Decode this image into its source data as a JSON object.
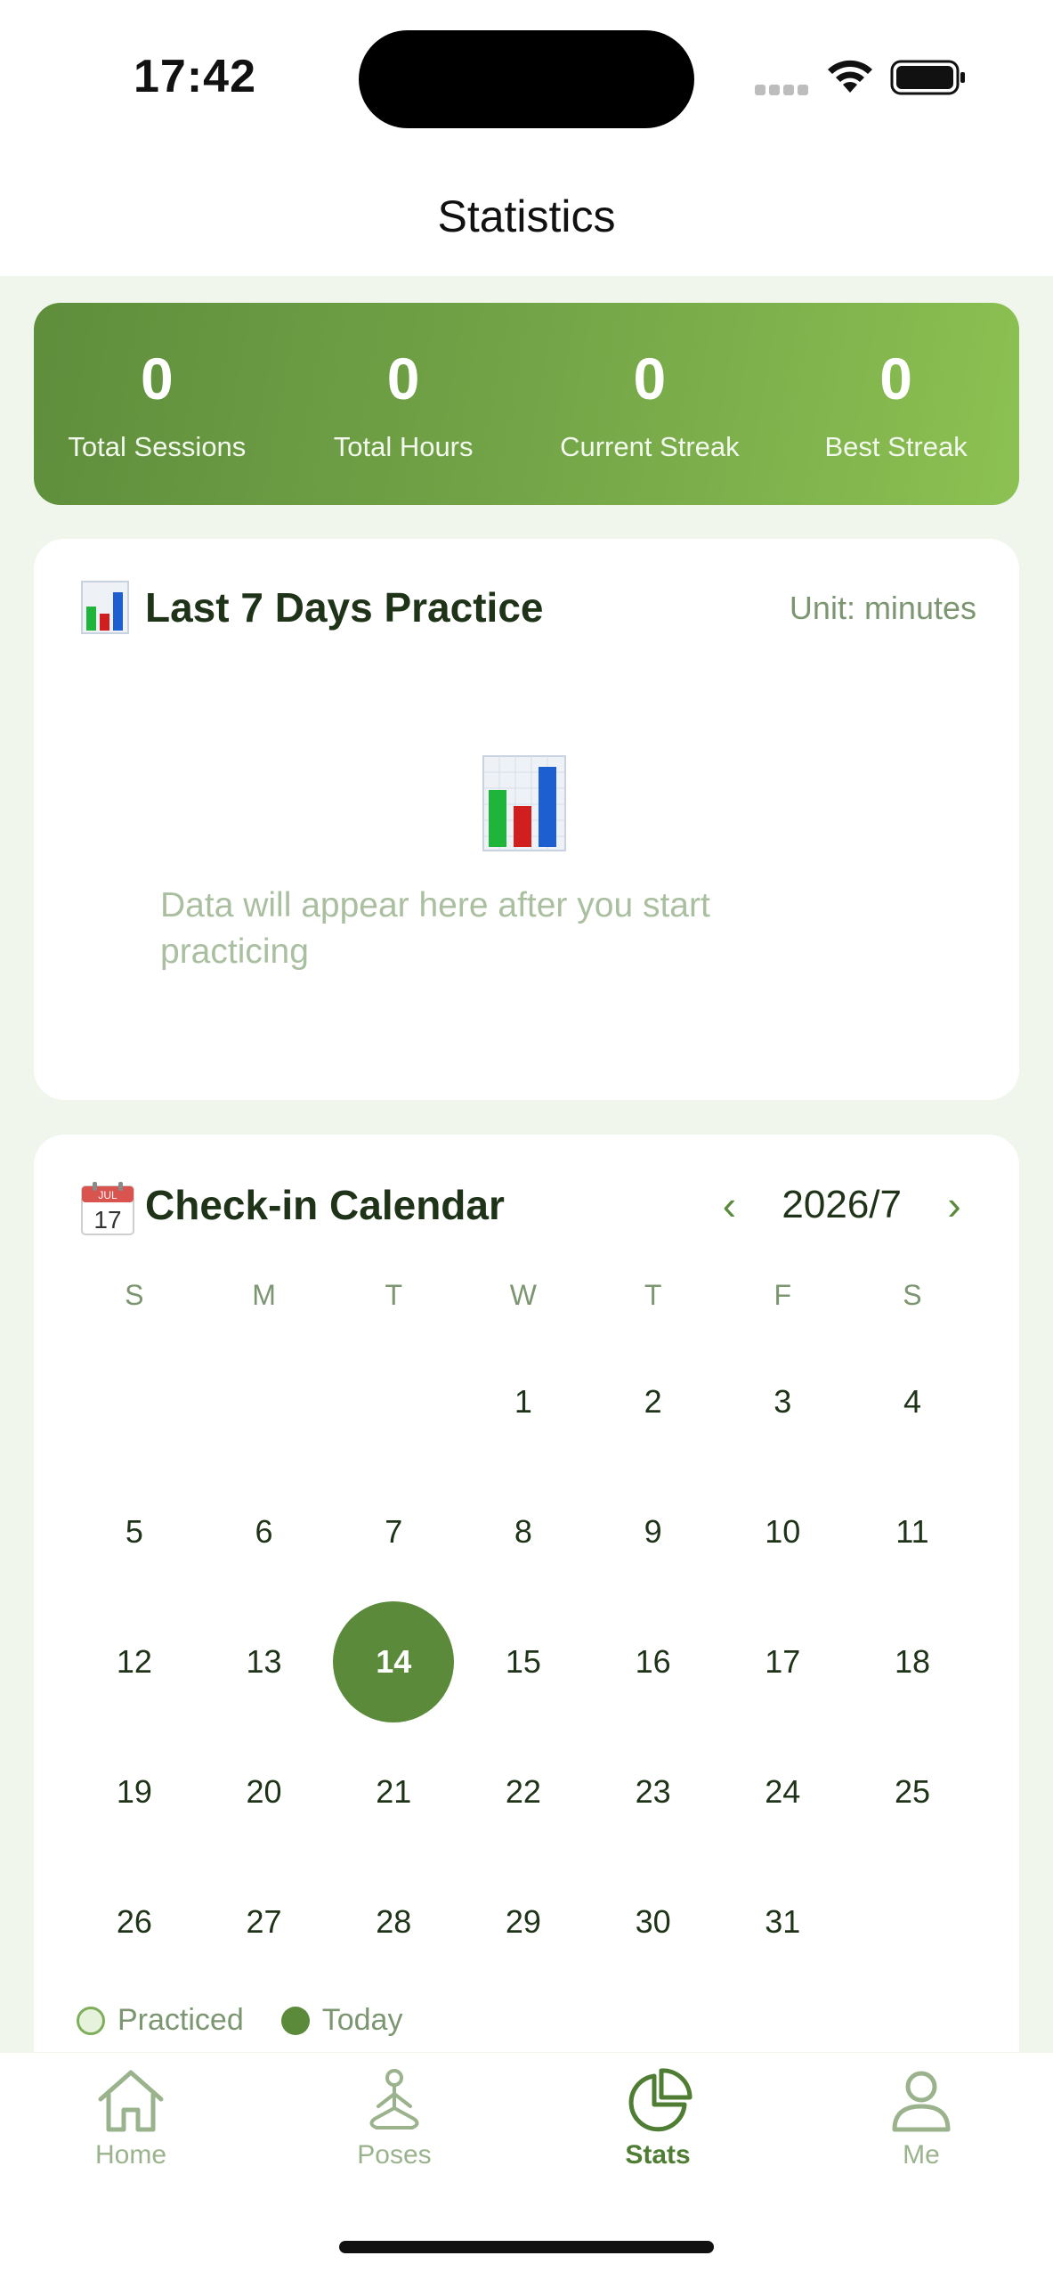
{
  "status_bar": {
    "time": "17:42"
  },
  "nav": {
    "title": "Statistics"
  },
  "summary": [
    {
      "value": "0",
      "label": "Total Sessions"
    },
    {
      "value": "0",
      "label": "Total Hours"
    },
    {
      "value": "0",
      "label": "Current Streak"
    },
    {
      "value": "0",
      "label": "Best Streak"
    }
  ],
  "practice_card": {
    "title": "Last 7 Days Practice",
    "unit": "Unit: minutes",
    "empty_text": "Data will appear here after you start practicing"
  },
  "calendar": {
    "title": "Check-in Calendar",
    "emoji_month": "JUL",
    "emoji_day": "17",
    "month_label": "2026/7",
    "prev_glyph": "‹",
    "next_glyph": "›",
    "weekdays": [
      "S",
      "M",
      "T",
      "W",
      "T",
      "F",
      "S"
    ],
    "days": [
      "",
      "",
      "",
      "1",
      "2",
      "3",
      "4",
      "5",
      "6",
      "7",
      "8",
      "9",
      "10",
      "11",
      "12",
      "13",
      "14",
      "15",
      "16",
      "17",
      "18",
      "19",
      "20",
      "21",
      "22",
      "23",
      "24",
      "25",
      "26",
      "27",
      "28",
      "29",
      "30",
      "31",
      ""
    ],
    "today": "14",
    "legend": {
      "practiced": "Practiced",
      "today": "Today"
    }
  },
  "tabs": [
    {
      "label": "Home",
      "icon": "home-icon",
      "active": false
    },
    {
      "label": "Poses",
      "icon": "yoga-icon",
      "active": false
    },
    {
      "label": "Stats",
      "icon": "pie-chart-icon",
      "active": true
    },
    {
      "label": "Me",
      "icon": "person-icon",
      "active": false
    }
  ],
  "colors": {
    "primary": "#5a8a3a",
    "banner_start": "#5f8e3c",
    "banner_end": "#8cc152",
    "background": "#f1f6ec",
    "muted_text": "#7b9670"
  }
}
